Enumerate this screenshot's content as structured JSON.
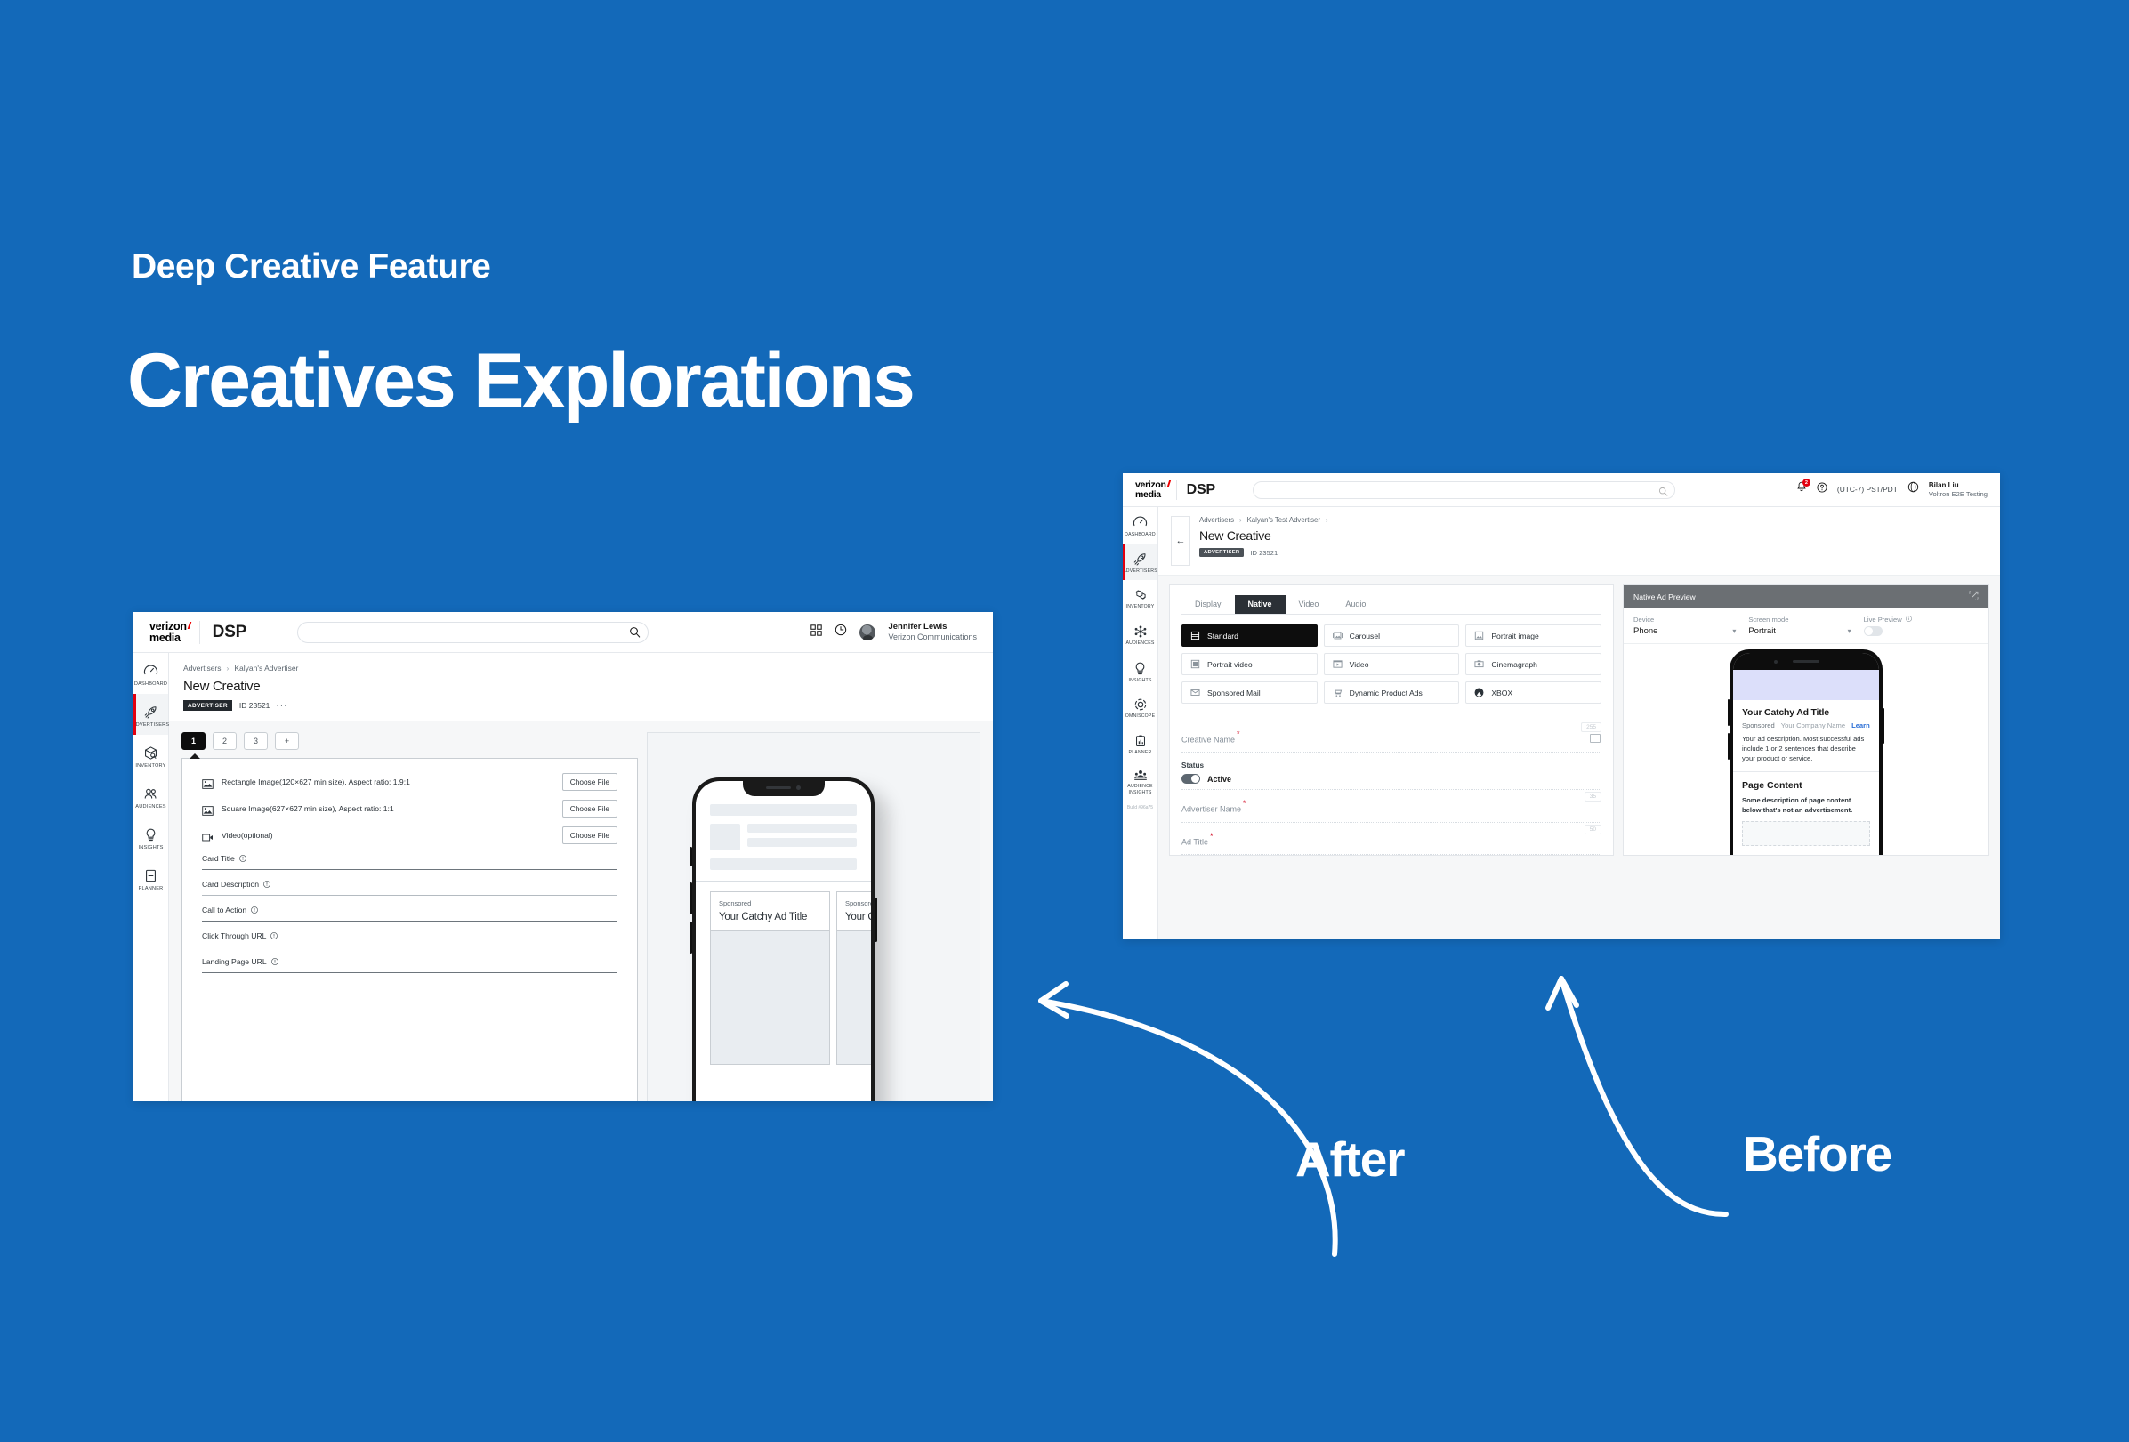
{
  "theme": {
    "background": "#1369b9",
    "accent_red": "#e3000f",
    "link_blue": "#2a6ed6"
  },
  "slide": {
    "kicker": "Deep Creative Feature",
    "headline": "Creatives Explorations"
  },
  "annotations": {
    "after_label": "After",
    "before_label": "Before"
  },
  "after": {
    "topbar": {
      "brand_line1": "verizon",
      "brand_line2": "media",
      "product": "DSP",
      "search_placeholder": "",
      "search_value": "",
      "icons": [
        "apps-grid-icon",
        "clock-icon"
      ],
      "user_name": "Jennifer Lewis",
      "user_org": "Verizon Communications"
    },
    "sidebar": [
      {
        "label": "DASHBOARD",
        "icon": "gauge-icon",
        "active": false
      },
      {
        "label": "ADVERTISERS",
        "icon": "rocket-icon",
        "active": true
      },
      {
        "label": "INVENTORY",
        "icon": "box-search-icon",
        "active": false
      },
      {
        "label": "AUDIENCES",
        "icon": "people-icon",
        "active": false
      },
      {
        "label": "INSIGHTS",
        "icon": "lightbulb-icon",
        "active": false
      },
      {
        "label": "PLANNER",
        "icon": "notebook-icon",
        "active": false
      }
    ],
    "breadcrumb": [
      "Advertisers",
      "Kalyan's Advertiser"
    ],
    "page_title": "New Creative",
    "tag": "ADVERTISER",
    "id_text": "ID 23521",
    "overflow": "···",
    "card_tabs": [
      {
        "label": "1",
        "active": true
      },
      {
        "label": "2",
        "active": false
      },
      {
        "label": "3",
        "active": false
      },
      {
        "label": "+",
        "active": false
      }
    ],
    "uploads": [
      {
        "icon": "image-icon",
        "label": "Rectangle Image(120×627 min size), Aspect ratio: 1.9:1",
        "button": "Choose File"
      },
      {
        "icon": "image-icon",
        "label": "Square Image(627×627 min size), Aspect ratio: 1:1",
        "button": "Choose File"
      },
      {
        "icon": "video-icon",
        "label": "Video(optional)",
        "button": "Choose File"
      }
    ],
    "fields": [
      {
        "label": "Card Title",
        "info": "info-icon",
        "value": ""
      },
      {
        "label": "Card Description",
        "info": "info-icon",
        "value": ""
      },
      {
        "label": "Call to Action",
        "info": "info-icon",
        "value": ""
      },
      {
        "label": "Click Through URL",
        "info": "info-icon",
        "value": ""
      },
      {
        "label": "Landing Page URL",
        "info": "info-icon",
        "value": ""
      }
    ],
    "preview_cards": [
      {
        "sponsored": "Sponsored",
        "title": "Your Catchy Ad Title"
      },
      {
        "sponsored": "Sponsored",
        "title": "Your Catchy Ad Title"
      }
    ]
  },
  "before": {
    "topbar": {
      "brand_line1": "verizon",
      "brand_line2": "media",
      "product": "DSP",
      "search_placeholder": "",
      "search_value": "",
      "notification_count": "2",
      "timezone": "(UTC-7) PST/PDT",
      "user_name": "Bilan Liu",
      "user_org": "Voltron E2E Testing"
    },
    "sidebar": [
      {
        "label": "DASHBOARD",
        "icon": "gauge-icon",
        "active": false
      },
      {
        "label": "ADVERTISERS",
        "icon": "rocket-icon",
        "active": true
      },
      {
        "label": "INVENTORY",
        "icon": "boxes-icon",
        "active": false
      },
      {
        "label": "AUDIENCES",
        "icon": "network-icon",
        "active": false
      },
      {
        "label": "INSIGHTS",
        "icon": "lightbulb-icon",
        "active": false
      },
      {
        "label": "OMNISCOPE",
        "icon": "circle-dashed-icon",
        "active": false
      },
      {
        "label": "PLANNER",
        "icon": "clipboard-chart-icon",
        "active": false
      },
      {
        "label": "AUDIENCE INSIGHTS",
        "icon": "people-group-icon",
        "active": false
      }
    ],
    "build": "Build #96a75",
    "back_icon": "arrow-left-icon",
    "breadcrumb": [
      "Advertisers",
      "Kalyan's Test Advertiser"
    ],
    "page_title": "New Creative",
    "tag": "ADVERTISER",
    "id_text": "ID 23521",
    "format_tabs": [
      {
        "label": "Display",
        "active": false
      },
      {
        "label": "Native",
        "active": true
      },
      {
        "label": "Video",
        "active": false
      },
      {
        "label": "Audio",
        "active": false
      }
    ],
    "format_tiles": [
      {
        "label": "Standard",
        "icon": "standard-layout-icon",
        "active": true
      },
      {
        "label": "Carousel",
        "icon": "carousel-icon",
        "active": false
      },
      {
        "label": "Portrait image",
        "icon": "portrait-image-icon",
        "active": false
      },
      {
        "label": "Portrait video",
        "icon": "portrait-video-icon",
        "active": false
      },
      {
        "label": "Video",
        "icon": "video-play-icon",
        "active": false
      },
      {
        "label": "Cinemagraph",
        "icon": "cinemagraph-icon",
        "active": false
      },
      {
        "label": "Sponsored Mail",
        "icon": "mail-icon",
        "active": false
      },
      {
        "label": "Dynamic Product Ads",
        "icon": "cart-icon",
        "active": false
      },
      {
        "label": "XBOX",
        "icon": "xbox-icon",
        "active": false
      }
    ],
    "fields": [
      {
        "label": "Creative Name",
        "required": "*",
        "counter": "255",
        "value": ""
      },
      {
        "label": "Advertiser Name",
        "required": "*",
        "counter": "35",
        "value": ""
      },
      {
        "label": "Ad Title",
        "required": "*",
        "counter": "50",
        "value": ""
      }
    ],
    "status": {
      "label": "Status",
      "value": "Active",
      "on": true
    },
    "preview": {
      "header": "Native Ad Preview",
      "expand_icon": "expand-icon",
      "device_label": "Device",
      "device_value": "Phone",
      "screen_label": "Screen mode",
      "screen_value": "Portrait",
      "live_label": "Live Preview",
      "live_info": "info-icon",
      "live_on": false,
      "ad": {
        "title": "Your Catchy Ad Title",
        "sponsored": "Sponsored",
        "company": "Your Company Name",
        "cta": "Learn More",
        "description": "Your ad description. Most successful ads include 1 or 2 sentences that describe your product or service."
      },
      "page": {
        "title": "Page Content",
        "description": "Some description of page content below that's not an advertisement."
      }
    }
  }
}
